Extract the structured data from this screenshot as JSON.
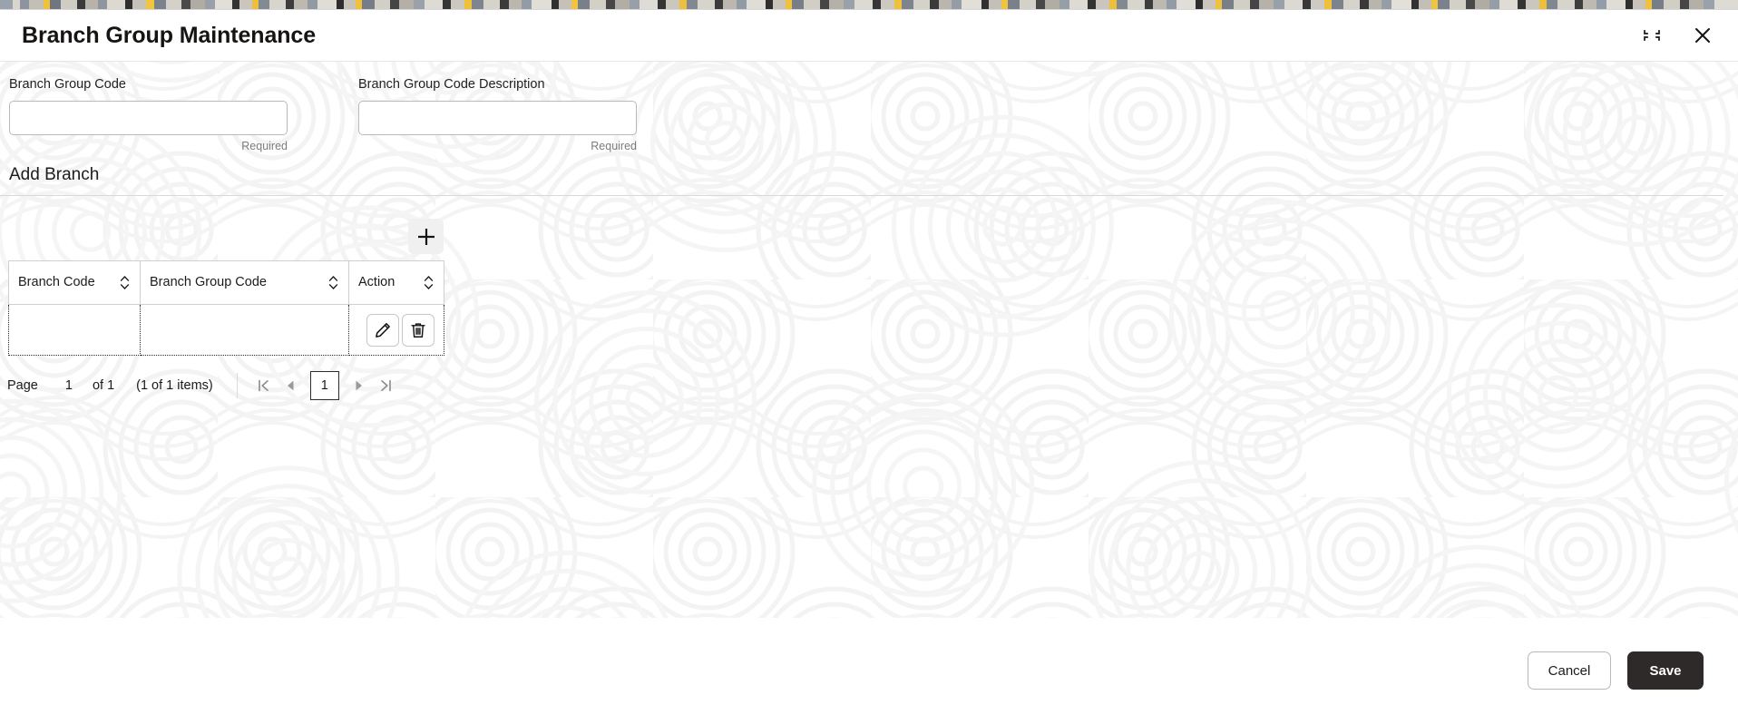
{
  "window": {
    "title": "Branch Group Maintenance",
    "minimize_icon": "collapse-icon",
    "close_icon": "close-icon"
  },
  "form": {
    "fields": [
      {
        "label": "Branch Group Code",
        "value": "",
        "placeholder": "",
        "hint": "Required"
      },
      {
        "label": "Branch Group Code Description",
        "value": "",
        "placeholder": "",
        "hint": "Required"
      }
    ]
  },
  "section": {
    "title": "Add Branch",
    "add_button_icon": "plus-icon"
  },
  "table": {
    "columns": [
      {
        "label": "Branch Code",
        "sort_icon": "sort-updown-icon"
      },
      {
        "label": "Branch Group Code",
        "sort_icon": "sort-updown-icon"
      },
      {
        "label": "Action",
        "sort_icon": "sort-updown-icon"
      }
    ],
    "rows": [
      {
        "branch_code": "",
        "branch_group_code": "",
        "actions": [
          {
            "name": "edit",
            "icon": "pencil-icon"
          },
          {
            "name": "delete",
            "icon": "trash-icon"
          }
        ]
      }
    ]
  },
  "pagination": {
    "page_label": "Page",
    "current_page": "1",
    "of_label": "of 1",
    "items_label": "(1 of 1 items)",
    "first_icon": "first-page-icon",
    "prev_icon": "prev-page-icon",
    "page_number": "1",
    "next_icon": "next-page-icon",
    "last_icon": "last-page-icon"
  },
  "footer": {
    "cancel_label": "Cancel",
    "save_label": "Save"
  },
  "colors": {
    "save_bg": "#2e2a29",
    "text": "#161513",
    "hint": "#7b7b7b",
    "border": "#b9b9b9",
    "watermark": "#f4f4f4"
  }
}
